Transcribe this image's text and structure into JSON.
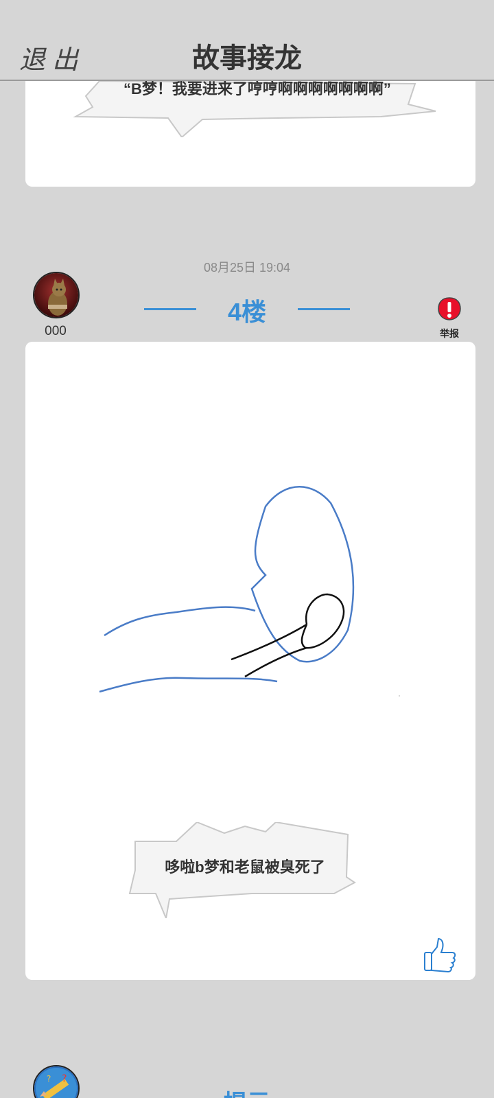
{
  "header": {
    "exit_label": "退出",
    "title": "故事接龙"
  },
  "previous_post": {
    "caption": "“B梦！我要进来了哼哼啊啊啊啊啊啊啊”"
  },
  "post": {
    "timestamp": "08月25日  19:04",
    "floor": "4楼",
    "username": "000",
    "report_label": "举报",
    "caption": "哆啦b梦和老鼠被臭死了",
    "drawing_colors": {
      "blue": "#4a7cc7",
      "black": "#111111"
    }
  },
  "next_section": {
    "label": "提示"
  },
  "colors": {
    "accent": "#3a8fd6",
    "report": "#e8102a",
    "background": "#d6d6d6"
  }
}
